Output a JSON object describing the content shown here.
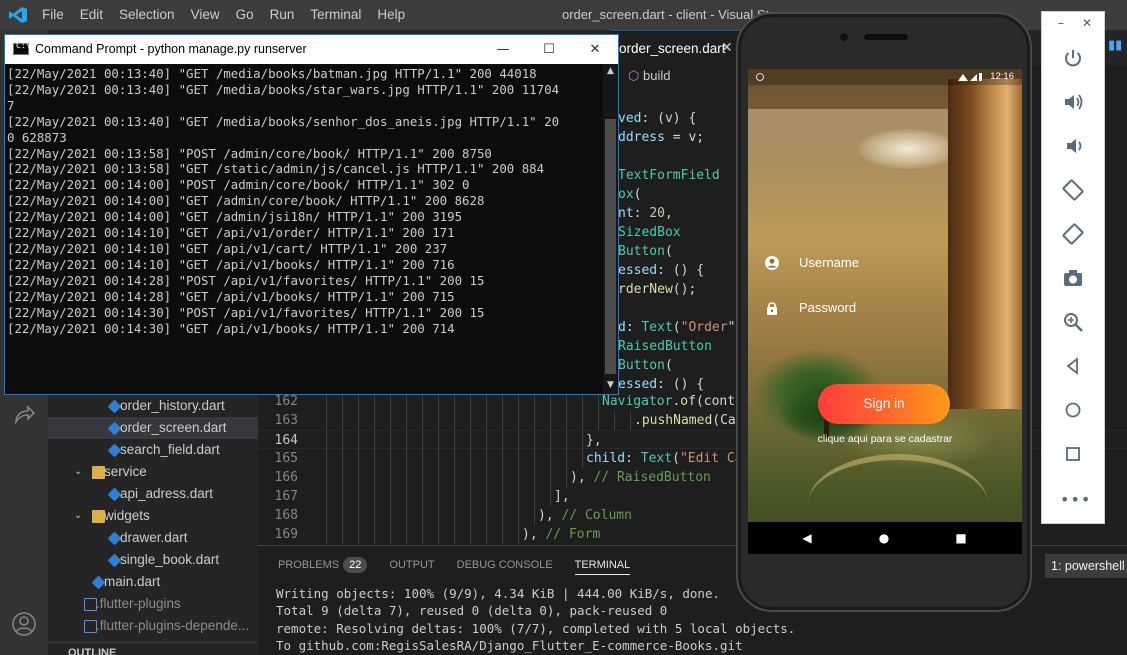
{
  "vscode": {
    "menu": [
      "File",
      "Edit",
      "Selection",
      "View",
      "Go",
      "Run",
      "Terminal",
      "Help"
    ],
    "window_title": "order_screen.dart - client - Visual Stu",
    "active_tab": "order_screen.dart",
    "tab_close": "✕",
    "breadcrumb": "build",
    "sidebar": {
      "items": [
        {
          "label": "order_history.dart",
          "kind": "dart",
          "depth": 3
        },
        {
          "label": "order_screen.dart",
          "kind": "dart",
          "depth": 3,
          "selected": true
        },
        {
          "label": "search_field.dart",
          "kind": "dart",
          "depth": 3
        },
        {
          "label": "service",
          "kind": "folder",
          "depth": 2
        },
        {
          "label": "api_adress.dart",
          "kind": "dart",
          "depth": 3
        },
        {
          "label": "widgets",
          "kind": "folder",
          "depth": 2
        },
        {
          "label": "drawer.dart",
          "kind": "dart",
          "depth": 3
        },
        {
          "label": "single_book.dart",
          "kind": "dart",
          "depth": 3
        },
        {
          "label": "main.dart",
          "kind": "dart",
          "depth": 2
        },
        {
          "label": ".flutter-plugins",
          "kind": "file",
          "depth": 1
        },
        {
          "label": ".flutter-plugins-depende...",
          "kind": "file",
          "depth": 1
        }
      ],
      "outline": "OUTLINE"
    },
    "code": {
      "visible_top": [
        {
          "parts": [
            [
              "prop",
              "ved"
            ],
            [
              "pl",
              ": (v) {"
            ]
          ]
        },
        {
          "parts": [
            [
              "prop",
              "ddress"
            ],
            [
              "pl",
              " = v;"
            ]
          ]
        },
        {
          "parts": [
            [
              "pl",
              ""
            ]
          ]
        },
        {
          "parts": [
            [
              "cls",
              "TextFormField"
            ]
          ]
        },
        {
          "parts": [
            [
              "cls",
              "ox"
            ],
            [
              "pl",
              "("
            ]
          ]
        },
        {
          "parts": [
            [
              "prop",
              "nt"
            ],
            [
              "pl",
              ": "
            ],
            [
              "num",
              "20"
            ],
            [
              "pl",
              ","
            ]
          ]
        },
        {
          "parts": [
            [
              "cls",
              "SizedBox"
            ]
          ]
        },
        {
          "parts": [
            [
              "cls",
              "Button"
            ],
            [
              "pl",
              "("
            ]
          ]
        },
        {
          "parts": [
            [
              "prop",
              "essed"
            ],
            [
              "pl",
              ": () {"
            ]
          ]
        },
        {
          "parts": [
            [
              "fn",
              "rderNew"
            ],
            [
              "pl",
              "();"
            ]
          ]
        },
        {
          "parts": [
            [
              "pl",
              ""
            ]
          ]
        },
        {
          "parts": [
            [
              "prop",
              "d"
            ],
            [
              "pl",
              ": "
            ],
            [
              "cls",
              "Text"
            ],
            [
              "pl",
              "("
            ],
            [
              "str",
              "\"Order"
            ],
            [
              "pl",
              "\")"
            ]
          ]
        },
        {
          "parts": [
            [
              "cls",
              "RaisedButton"
            ]
          ]
        },
        {
          "parts": [
            [
              "cls",
              "Button"
            ],
            [
              "pl",
              "("
            ]
          ]
        },
        {
          "parts": [
            [
              "prop",
              "essed"
            ],
            [
              "pl",
              ": () {"
            ]
          ]
        }
      ],
      "numbered": [
        {
          "n": "162",
          "indent": 344,
          "parts": [
            [
              "cls",
              "Navigator"
            ],
            [
              "pl",
              "."
            ],
            [
              "fn",
              "of"
            ],
            [
              "pl",
              "(conte"
            ]
          ]
        },
        {
          "n": "163",
          "indent": 376,
          "parts": [
            [
              "pl",
              "."
            ],
            [
              "fn",
              "pushNamed"
            ],
            [
              "pl",
              "(Car"
            ]
          ]
        },
        {
          "n": "164",
          "indent": 328,
          "parts": [
            [
              "pl",
              "},"
            ]
          ],
          "current": true
        },
        {
          "n": "165",
          "indent": 328,
          "parts": [
            [
              "prop",
              "child"
            ],
            [
              "pl",
              ": "
            ],
            [
              "cls",
              "Text"
            ],
            [
              "pl",
              "("
            ],
            [
              "str",
              "\"Edit Ca"
            ]
          ]
        },
        {
          "n": "166",
          "indent": 312,
          "parts": [
            [
              "pl",
              "), "
            ],
            [
              "cm",
              "// RaisedButton"
            ]
          ]
        },
        {
          "n": "167",
          "indent": 296,
          "parts": [
            [
              "pl",
              "],"
            ]
          ]
        },
        {
          "n": "168",
          "indent": 280,
          "parts": [
            [
              "pl",
              "), "
            ],
            [
              "cm",
              "// Column"
            ]
          ]
        },
        {
          "n": "169",
          "indent": 264,
          "parts": [
            [
              "pl",
              "), "
            ],
            [
              "cm",
              "// Form"
            ]
          ]
        }
      ]
    },
    "panel": {
      "tabs": [
        "PROBLEMS",
        "OUTPUT",
        "DEBUG CONSOLE",
        "TERMINAL"
      ],
      "problems_count": "22",
      "active": "TERMINAL",
      "terminal_select": "1: powershell",
      "lines": [
        "Writing objects: 100% (9/9), 4.34 KiB | 444.00 KiB/s, done.",
        "Total 9 (delta 7), reused 0 (delta 0), pack-reused 0",
        "remote: Resolving deltas: 100% (7/7), completed with 5 local objects.",
        "To github.com:RegisSalesRA/Django_Flutter_E-commerce-Books.git"
      ]
    }
  },
  "cmd": {
    "title": "Command Prompt - python  manage.py runserver",
    "lines": [
      "[22/May/2021 00:13:40] \"GET /media/books/batman.jpg HTTP/1.1\" 200 44018",
      "[22/May/2021 00:13:40] \"GET /media/books/star_wars.jpg HTTP/1.1\" 200 11704",
      "7",
      "[22/May/2021 00:13:40] \"GET /media/books/senhor_dos_aneis.jpg HTTP/1.1\" 20",
      "0 628873",
      "[22/May/2021 00:13:58] \"POST /admin/core/book/ HTTP/1.1\" 200 8750",
      "[22/May/2021 00:13:58] \"GET /static/admin/js/cancel.js HTTP/1.1\" 200 884",
      "[22/May/2021 00:14:00] \"POST /admin/core/book/ HTTP/1.1\" 302 0",
      "[22/May/2021 00:14:00] \"GET /admin/core/book/ HTTP/1.1\" 200 8628",
      "[22/May/2021 00:14:00] \"GET /admin/jsi18n/ HTTP/1.1\" 200 3195",
      "[22/May/2021 00:14:10] \"GET /api/v1/order/ HTTP/1.1\" 200 171",
      "[22/May/2021 00:14:10] \"GET /api/v1/cart/ HTTP/1.1\" 200 237",
      "[22/May/2021 00:14:10] \"GET /api/v1/books/ HTTP/1.1\" 200 716",
      "[22/May/2021 00:14:28] \"POST /api/v1/favorites/ HTTP/1.1\" 200 15",
      "[22/May/2021 00:14:28] \"GET /api/v1/books/ HTTP/1.1\" 200 715",
      "[22/May/2021 00:14:30] \"POST /api/v1/favorites/ HTTP/1.1\" 200 15",
      "[22/May/2021 00:14:30] \"GET /api/v1/books/ HTTP/1.1\" 200 714"
    ],
    "icon_text": "C:\\",
    "minimize": "—",
    "maximize": "☐",
    "close": "✕"
  },
  "phone": {
    "status_time": "12:16",
    "username_placeholder": "Username",
    "password_placeholder": "Password",
    "signin_label": "Sign in",
    "register_link": "clique aqui para se cadastrar",
    "button_gradient": [
      "#ff3d3d",
      "#ff9a1a"
    ]
  },
  "emulator": {
    "tools": [
      "power-icon",
      "volume-up-icon",
      "volume-down-icon",
      "rotate-left-icon",
      "rotate-right-icon",
      "camera-icon",
      "zoom-icon",
      "back-icon",
      "home-icon",
      "overview-icon"
    ],
    "more": "•••",
    "minimize": "–",
    "close": "✕"
  },
  "colors": {
    "accent": "#007acc",
    "titlebar": "#3c3c3c",
    "sidebar": "#252526",
    "editor": "#1e1e1e"
  }
}
